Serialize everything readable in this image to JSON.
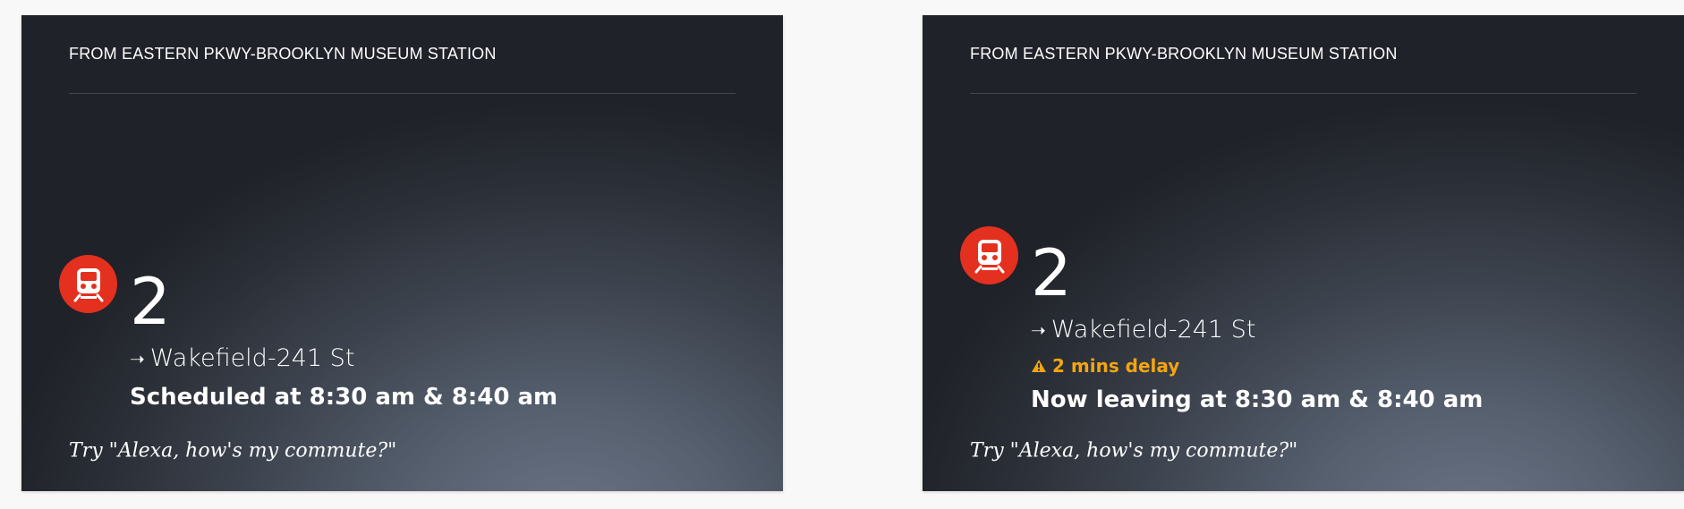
{
  "cards": [
    {
      "header": "FROM EASTERN PKWY-BROOKLYN MUSEUM STATION",
      "route": "2",
      "destination": "Wakefield-241 St",
      "schedule": "Scheduled at 8:30 am & 8:40 am",
      "hint": "Try \"Alexa, how's my commute?\""
    },
    {
      "header": "FROM EASTERN PKWY-BROOKLYN MUSEUM STATION",
      "route": "2",
      "destination": "Wakefield-241 St",
      "delay": "2 mins delay",
      "schedule": "Now leaving at 8:30 am & 8:40 am",
      "hint": "Try \"Alexa, how's my commute?\""
    }
  ],
  "icons": {
    "train": "train-icon",
    "arrow": "arrow-right-icon",
    "warning": "warning-icon"
  },
  "colors": {
    "badge": "#e4301f",
    "delay": "#f3a512",
    "text": "#ffffff"
  }
}
